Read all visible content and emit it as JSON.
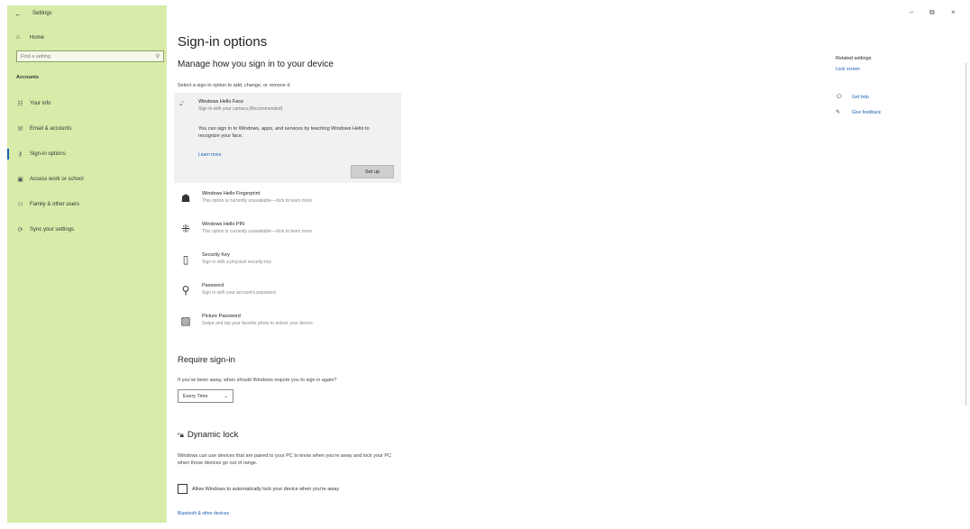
{
  "window": {
    "title": "Settings",
    "minimize": "–",
    "maximize": "⧉",
    "close": "×"
  },
  "sidebar": {
    "home": "Home",
    "search_placeholder": "Find a setting",
    "section": "Accounts",
    "items": [
      {
        "label": "Your info",
        "icon": "person-card-icon",
        "glyph": "☷"
      },
      {
        "label": "Email & accounts",
        "icon": "mail-icon",
        "glyph": "✉"
      },
      {
        "label": "Sign-in options",
        "icon": "key-icon",
        "glyph": "⚷"
      },
      {
        "label": "Access work or school",
        "icon": "briefcase-icon",
        "glyph": "▣"
      },
      {
        "label": "Family & other users",
        "icon": "people-icon",
        "glyph": "⚇"
      },
      {
        "label": "Sync your settings",
        "icon": "sync-icon",
        "glyph": "⟳"
      }
    ]
  },
  "main": {
    "title": "Sign-in options",
    "subtitle": "Manage how you sign in to your device",
    "prompt": "Select a sign-in option to add, change, or remove it.",
    "face": {
      "title": "Windows Hello Face",
      "sub": "Sign in with your camera (Recommended)",
      "desc": "You can sign in to Windows, apps, and services by teaching Windows Hello to recognize your face.",
      "learn": "Learn more",
      "setup": "Set up"
    },
    "options": [
      {
        "title": "Windows Hello Fingerprint",
        "sub": "This option is currently unavailable—click to learn more",
        "icon": "fingerprint-icon",
        "glyph": "☗"
      },
      {
        "title": "Windows Hello PIN",
        "sub": "This option is currently unavailable—click to learn more",
        "icon": "pin-keypad-icon",
        "glyph": "⁜"
      },
      {
        "title": "Security Key",
        "sub": "Sign in with a physical security key",
        "icon": "security-key-icon",
        "glyph": "▯"
      },
      {
        "title": "Password",
        "sub": "Sign in with your account's password",
        "icon": "password-key-icon",
        "glyph": "⚲"
      },
      {
        "title": "Picture Password",
        "sub": "Swipe and tap your favorite photo to unlock your device",
        "icon": "picture-icon",
        "glyph": "▨"
      }
    ],
    "require": {
      "title": "Require sign-in",
      "question": "If you've been away, when should Windows require you to sign in again?",
      "value": "Every Time"
    },
    "dynamic_lock": {
      "title": "Dynamic lock",
      "desc": "Windows can use devices that are paired to your PC to know when you're away and lock your PC when those devices go out of range.",
      "checkbox_label": "Allow Windows to automatically lock your device when you're away",
      "link": "Bluetooth & other devices"
    }
  },
  "related": {
    "heading": "Related settings",
    "lock_screen": "Lock screen",
    "help": "Get help",
    "feedback": "Give feedback"
  }
}
